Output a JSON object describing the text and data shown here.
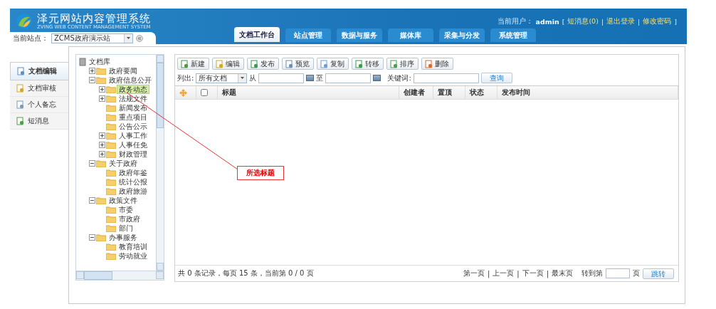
{
  "header": {
    "title": "泽元网站内容管理系统",
    "subtitle": "ZVING WEB CONTENT MANAGEMENT SYSTEM",
    "site_label": "当前站点：",
    "site": "ZCMS政府演示站",
    "user_label": "当前用户：",
    "user": "admin",
    "bracket_open": "[",
    "links": [
      "短消息(0)",
      "退出登录",
      "修改密码"
    ],
    "separator": "|",
    "bracket_close": "]"
  },
  "tabs": [
    {
      "label": "文档工作台",
      "selected": true
    },
    {
      "label": "站点管理",
      "selected": false
    },
    {
      "label": "数据与服务",
      "selected": false
    },
    {
      "label": "媒体库",
      "selected": false
    },
    {
      "label": "采集与分发",
      "selected": false
    },
    {
      "label": "系统管理",
      "selected": false
    }
  ],
  "sidebar": {
    "items": [
      {
        "label": "文档编辑",
        "selected": true
      },
      {
        "label": "文档审核",
        "selected": false
      },
      {
        "label": "个人备忘",
        "selected": false
      },
      {
        "label": "短消息",
        "selected": false
      }
    ]
  },
  "tree": {
    "label": "文档库",
    "children": [
      {
        "label": "政府要闻",
        "expanded": false,
        "selected": false
      },
      {
        "label": "政府信息公开",
        "expanded": true,
        "selected": false,
        "children": [
          {
            "label": "政务动态",
            "expanded": false,
            "selected": true
          },
          {
            "label": "法规文件",
            "expanded": false,
            "selected": false
          },
          {
            "label": "新闻发布",
            "selected": false
          },
          {
            "label": "重点项目",
            "selected": false
          },
          {
            "label": "公告公示",
            "selected": false
          },
          {
            "label": "人事工作",
            "expanded": false,
            "selected": false
          },
          {
            "label": "人事任免",
            "expanded": false,
            "selected": false
          },
          {
            "label": "财政管理",
            "expanded": false,
            "selected": false
          }
        ]
      },
      {
        "label": "关于政府",
        "expanded": true,
        "selected": false,
        "children": [
          {
            "label": "政府年鉴",
            "selected": false
          },
          {
            "label": "统计公报",
            "selected": false
          },
          {
            "label": "政府旅游",
            "selected": false
          }
        ]
      },
      {
        "label": "政策文件",
        "expanded": true,
        "selected": false,
        "children": [
          {
            "label": "市委",
            "selected": false
          },
          {
            "label": "市政府",
            "selected": false
          },
          {
            "label": "部门",
            "selected": false
          }
        ]
      },
      {
        "label": "办事服务",
        "expanded": true,
        "selected": false,
        "children": [
          {
            "label": "教育培训",
            "selected": false
          },
          {
            "label": "劳动就业",
            "selected": false
          }
        ]
      }
    ]
  },
  "toolbar": [
    "新建",
    "编辑",
    "发布",
    "预览",
    "复制",
    "转移",
    "排序",
    "删除"
  ],
  "filter": {
    "list_label": "列出:",
    "list_value": "所有文档",
    "from_label": "从",
    "to_label": "至",
    "keyword_label": "关键词:",
    "search_button": "查询"
  },
  "table": {
    "select_all_checked": false,
    "columns": [
      "标题",
      "创建者",
      "置顶",
      "状态",
      "发布时间"
    ]
  },
  "pager": {
    "summary": "共 0 条记录，每页 15 条，当前第 0 / 0 页",
    "links": [
      "第一页",
      "上一页",
      "下一页",
      "最末页"
    ],
    "separator": "|",
    "goto_label": "转到第",
    "page_unit": "页",
    "go_button": "跳转"
  },
  "annotation": {
    "text": "所选标题"
  }
}
